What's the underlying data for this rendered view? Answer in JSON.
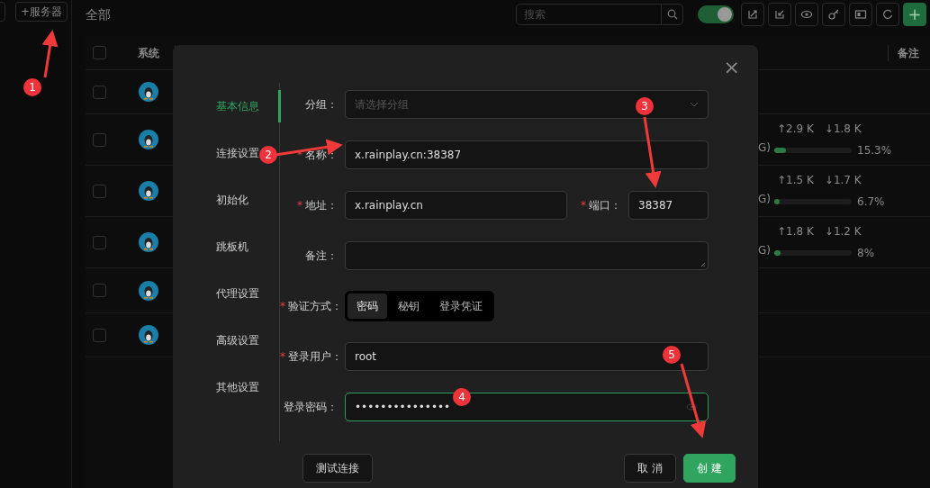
{
  "sidebar": {
    "add_button": "+服务器"
  },
  "header": {
    "title": "全部",
    "search": {
      "placeholder": "搜索"
    },
    "toggle": {
      "on": true
    },
    "add_label": "+"
  },
  "table": {
    "columns": [
      "系统",
      "备注"
    ],
    "select_all": {
      "checked": false
    },
    "rows": [
      {
        "checked": false
      },
      {
        "checked": false,
        "disk": "G)",
        "up": "↑2.9 K",
        "down": "↓1.8 K",
        "level": 0.153,
        "reading": "15.3%"
      },
      {
        "checked": false,
        "disk": "G)",
        "up": "↑1.5 K",
        "down": "↓1.7 K",
        "level": 0.067,
        "reading": "6.7%"
      },
      {
        "checked": false,
        "disk": "G)",
        "up": "↑1.8 K",
        "down": "↓1.2 K",
        "level": 0.08,
        "reading": "8%"
      },
      {
        "checked": false
      },
      {
        "checked": false
      }
    ]
  },
  "dialog": {
    "close": "×",
    "nav": [
      {
        "label": "基本信息",
        "selected": true
      },
      {
        "label": "连接设置",
        "selected": false
      },
      {
        "label": "初始化",
        "selected": false
      },
      {
        "label": "跳板机",
        "selected": false
      },
      {
        "label": "代理设置",
        "selected": false
      },
      {
        "label": "高级设置",
        "selected": false
      },
      {
        "label": "其他设置",
        "selected": false
      }
    ],
    "fields": [
      {
        "kind": "select",
        "label": "分组：",
        "placeholder": "请选择分组"
      },
      {
        "kind": "text",
        "label": "名称：",
        "required_mark": "*",
        "value": "x.rainplay.cn:38387"
      },
      {
        "kind": "address",
        "label": "地址：",
        "required_mark": "*",
        "value": "x.rainplay.cn",
        "port_label": "端口：",
        "port_required_mark": "*",
        "port_value": "38387"
      },
      {
        "kind": "textarea",
        "label": "备注："
      },
      {
        "kind": "segmented",
        "label": "验证方式：",
        "required_mark": "*",
        "options": [
          {
            "label": "密码",
            "selected": true
          },
          {
            "label": "秘钥",
            "selected": false
          },
          {
            "label": "登录凭证",
            "selected": false
          }
        ]
      },
      {
        "kind": "text",
        "label": "登录用户：",
        "required_mark": "*",
        "value": "root"
      },
      {
        "kind": "password",
        "label": "登录密码：",
        "value": "•••••••••••••••",
        "focused": true
      }
    ],
    "buttons": {
      "test": "测试连接",
      "cancel": "取 消",
      "create": "创 建"
    }
  },
  "annotations": [
    {
      "number": "1"
    },
    {
      "number": "2"
    },
    {
      "number": "3"
    },
    {
      "number": "4"
    },
    {
      "number": "5"
    }
  ]
}
